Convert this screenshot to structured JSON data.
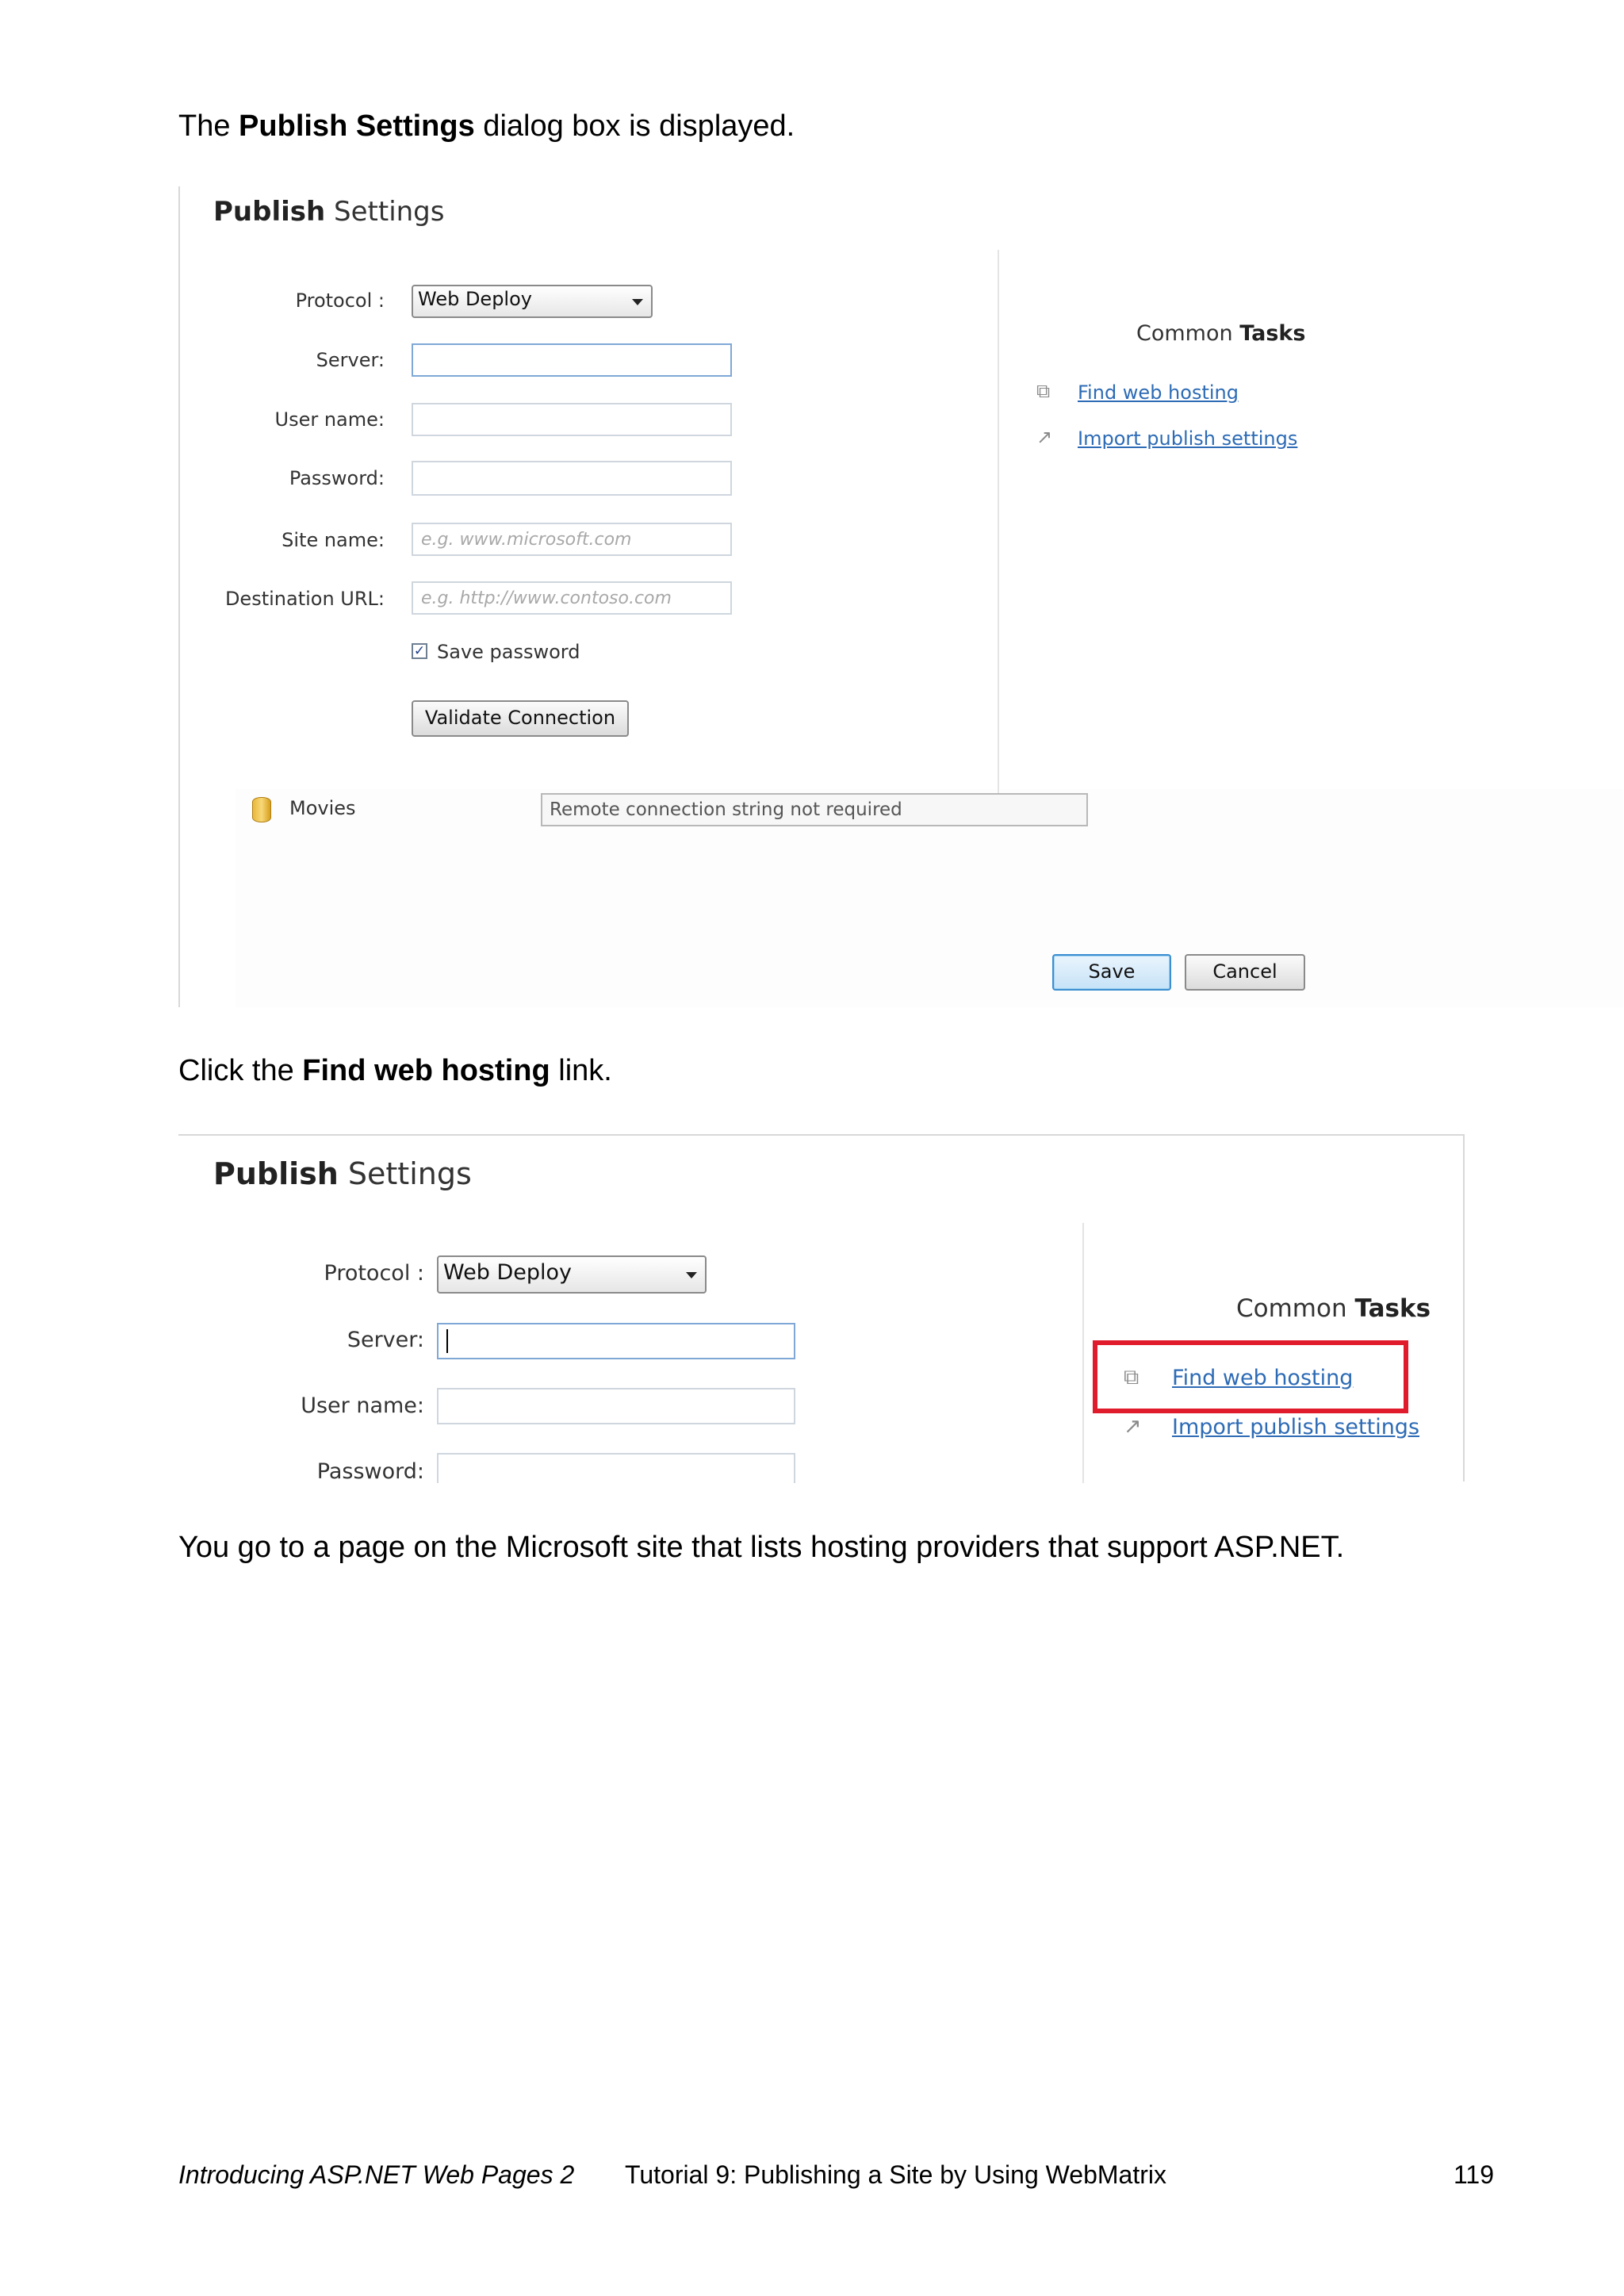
{
  "intro": {
    "prefix": "The ",
    "bold": "Publish Settings",
    "suffix": " dialog box is displayed."
  },
  "dialog1": {
    "title_bold": "Publish",
    "title_rest": " Settings",
    "labels": {
      "protocol": "Protocol :",
      "server": "Server:",
      "username": "User name:",
      "password": "Password:",
      "sitename": "Site name:",
      "destination": "Destination URL:"
    },
    "protocol_value": "Web Deploy",
    "sitename_placeholder": "e.g. www.microsoft.com",
    "destination_placeholder": "e.g. http://www.contoso.com",
    "save_password_label": "Save password",
    "save_password_checked": true,
    "validate_button": "Validate Connection",
    "common_tasks_light": "Common ",
    "common_tasks_bold": "Tasks",
    "find_hosting": "Find web hosting",
    "import_settings": "Import publish settings",
    "database_name": "Movies",
    "connection_string": "Remote connection string not required",
    "save_button": "Save",
    "cancel_button": "Cancel"
  },
  "instruction": {
    "prefix": "Click the ",
    "bold": "Find web hosting",
    "suffix": " link."
  },
  "dialog2": {
    "title_bold": "Publish",
    "title_rest": " Settings",
    "labels": {
      "protocol": "Protocol :",
      "server": "Server:",
      "username": "User name:",
      "password": "Password:"
    },
    "protocol_value": "Web Deploy",
    "common_tasks_light": "Common ",
    "common_tasks_bold": "Tasks",
    "find_hosting": "Find web hosting",
    "import_settings": "Import publish settings",
    "highlight_color": "#e01b2b"
  },
  "result": {
    "text": "You go to a page on the Microsoft site that lists hosting providers that support ASP.NET."
  },
  "footer": {
    "book": "Introducing ASP.NET Web Pages 2",
    "chapter": "Tutorial 9: Publishing a Site by Using WebMatrix",
    "page": "119"
  }
}
